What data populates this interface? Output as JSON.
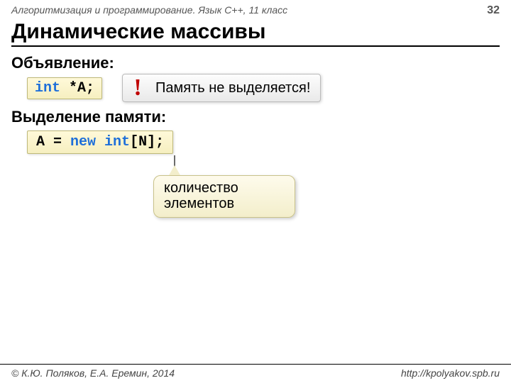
{
  "header": {
    "course": "Алгоритмизация и программирование. Язык C++, 11 класс",
    "page": "32"
  },
  "title": "Динамические массивы",
  "section1": {
    "label": "Объявление:",
    "code_kw": "int",
    "code_rest": " *A;"
  },
  "warning": {
    "mark": "!",
    "text": "Память не выделяется!"
  },
  "section2": {
    "label": "Выделение памяти:",
    "code_pre": "A = ",
    "code_kw1": "new",
    "code_mid": " ",
    "code_kw2": "int",
    "code_post": "[N];"
  },
  "callout": "количество элементов",
  "footer": {
    "left": "© К.Ю. Поляков, Е.А. Еремин, 2014",
    "right": "http://kpolyakov.spb.ru"
  }
}
